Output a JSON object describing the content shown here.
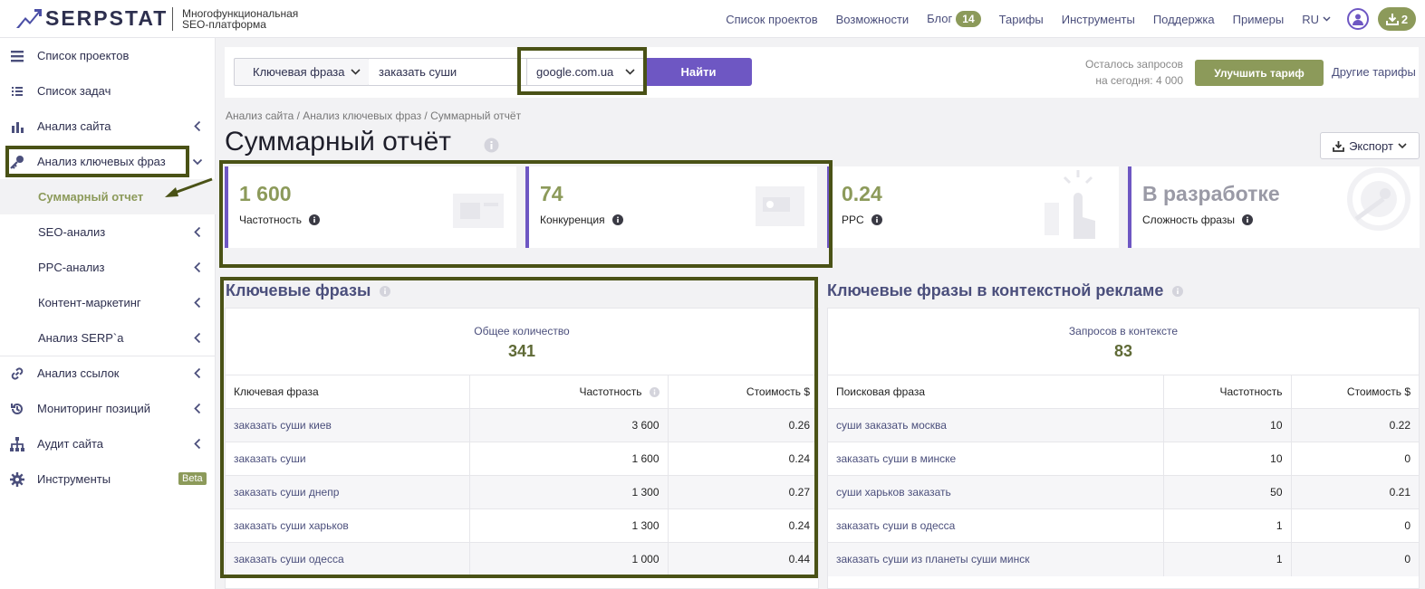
{
  "header": {
    "logo": "SERPSTAT",
    "tagline_line1": "Многофункциональная",
    "tagline_line2": "SEO-платформа",
    "nav": [
      {
        "label": "Список проектов"
      },
      {
        "label": "Возможности"
      },
      {
        "label": "Блог",
        "badge": "14"
      },
      {
        "label": "Тарифы"
      },
      {
        "label": "Инструменты"
      },
      {
        "label": "Поддержка"
      },
      {
        "label": "Примеры"
      }
    ],
    "lang": "RU",
    "downloads_count": "2"
  },
  "sidebar": {
    "items": [
      {
        "label": "Список проектов",
        "icon": "menu-icon"
      },
      {
        "label": "Список задач",
        "icon": "task-list-icon"
      },
      {
        "label": "Анализ сайта",
        "icon": "site-analysis-icon"
      },
      {
        "label": "Анализ ключевых фраз",
        "icon": "key-icon"
      },
      {
        "label": "Суммарный отчет",
        "active": true
      },
      {
        "label": "SEO-анализ"
      },
      {
        "label": "PPC-анализ"
      },
      {
        "label": "Контент-маркетинг"
      },
      {
        "label": "Анализ SERP`a"
      },
      {
        "label": "Анализ ссылок",
        "icon": "link-icon"
      },
      {
        "label": "Мониторинг позиций",
        "icon": "history-icon"
      },
      {
        "label": "Аудит сайта",
        "icon": "sitemap-icon"
      },
      {
        "label": "Инструменты",
        "icon": "gear-icon",
        "badge": "Beta"
      }
    ]
  },
  "search": {
    "type_label": "Ключевая фраза",
    "query_value": "заказать суши",
    "database": "google.com.ua",
    "find_label": "Найти",
    "quota_line1": "Осталось запросов",
    "quota_line2": "на сегодня: 4 000",
    "upgrade_label": "Улучшить тариф",
    "other_plans_label": "Другие тарифы"
  },
  "breadcrumb": "Анализ сайта / Анализ ключевых фраз / Суммарный отчёт",
  "page_title": "Суммарный отчёт",
  "export_label": "Экспорт",
  "stats": [
    {
      "value": "1 600",
      "label": "Частотность"
    },
    {
      "value": "74",
      "label": "Конкуренция"
    },
    {
      "value": "0.24",
      "label": "PPC"
    },
    {
      "value": "В разработке",
      "label": "Сложность фразы",
      "muted": true
    }
  ],
  "keywords": {
    "title": "Ключевые фразы",
    "summary_label": "Общее количество",
    "summary_value": "341",
    "columns": [
      "Ключевая фраза",
      "Частотность",
      "Стоимость $"
    ],
    "rows": [
      [
        "заказать суши киев",
        "3 600",
        "0.26"
      ],
      [
        "заказать суши",
        "1 600",
        "0.24"
      ],
      [
        "заказать суши днепр",
        "1 300",
        "0.27"
      ],
      [
        "заказать суши харьков",
        "1 300",
        "0.24"
      ],
      [
        "заказать суши одесса",
        "1 000",
        "0.44"
      ]
    ]
  },
  "ads": {
    "title": "Ключевые фразы в контекстной рекламе",
    "summary_label": "Запросов в контексте",
    "summary_value": "83",
    "columns": [
      "Поисковая фраза",
      "Частотность",
      "Стоимость $"
    ],
    "rows": [
      [
        "суши заказать москва",
        "10",
        "0.22"
      ],
      [
        "заказать суши в минске",
        "10",
        "0"
      ],
      [
        "суши харьков заказать",
        "50",
        "0.21"
      ],
      [
        "заказать суши в одесса",
        "1",
        "0"
      ],
      [
        "заказать суши из планеты суши минск",
        "1",
        "0"
      ]
    ]
  },
  "colors": {
    "accent": "#6e57c3",
    "brand_olive": "#8c9a5a",
    "annotation": "#4a5216"
  }
}
